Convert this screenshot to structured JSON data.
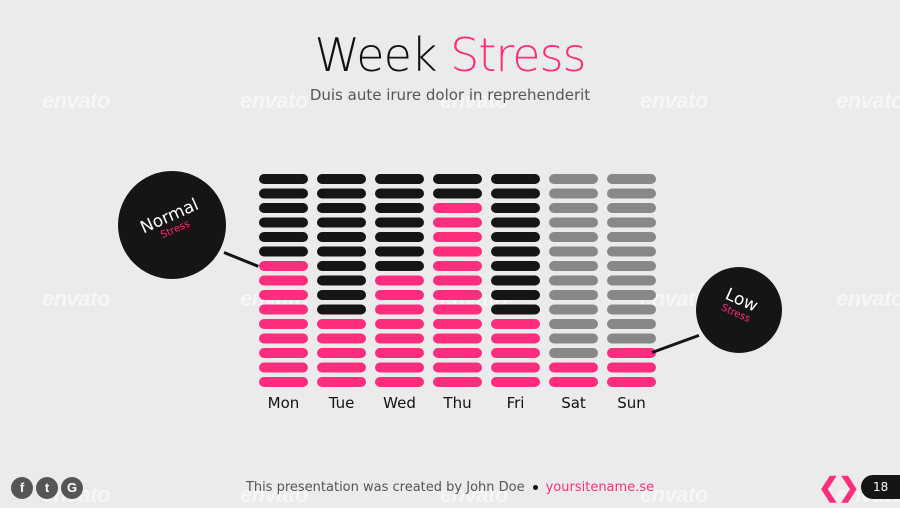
{
  "header": {
    "title_part1": "Week ",
    "title_part2": "Stress",
    "subtitle": "Duis aute irure dolor in reprehenderit"
  },
  "colors": {
    "accent": "#ff2d7e",
    "dark": "#151515",
    "inactive": "#888888"
  },
  "chart_data": {
    "type": "bar",
    "categories": [
      "Mon",
      "Tue",
      "Wed",
      "Thu",
      "Fri",
      "Sat",
      "Sun"
    ],
    "segments_total": 15,
    "values": [
      9,
      5,
      8,
      13,
      5,
      2,
      3
    ],
    "top_style": [
      "dark",
      "dark",
      "dark",
      "dark",
      "dark",
      "gray",
      "gray"
    ],
    "annotations": [
      {
        "label": "Normal",
        "sub": "Stress"
      },
      {
        "label": "Low",
        "sub": "Stress"
      }
    ]
  },
  "footer": {
    "credit": "This presentation was created by John Doe",
    "site": "yoursitename.se",
    "page": "18"
  },
  "social": [
    "f",
    "t",
    "G"
  ],
  "nav": {
    "prev": "❮",
    "next": "❯"
  },
  "watermark": "envato"
}
